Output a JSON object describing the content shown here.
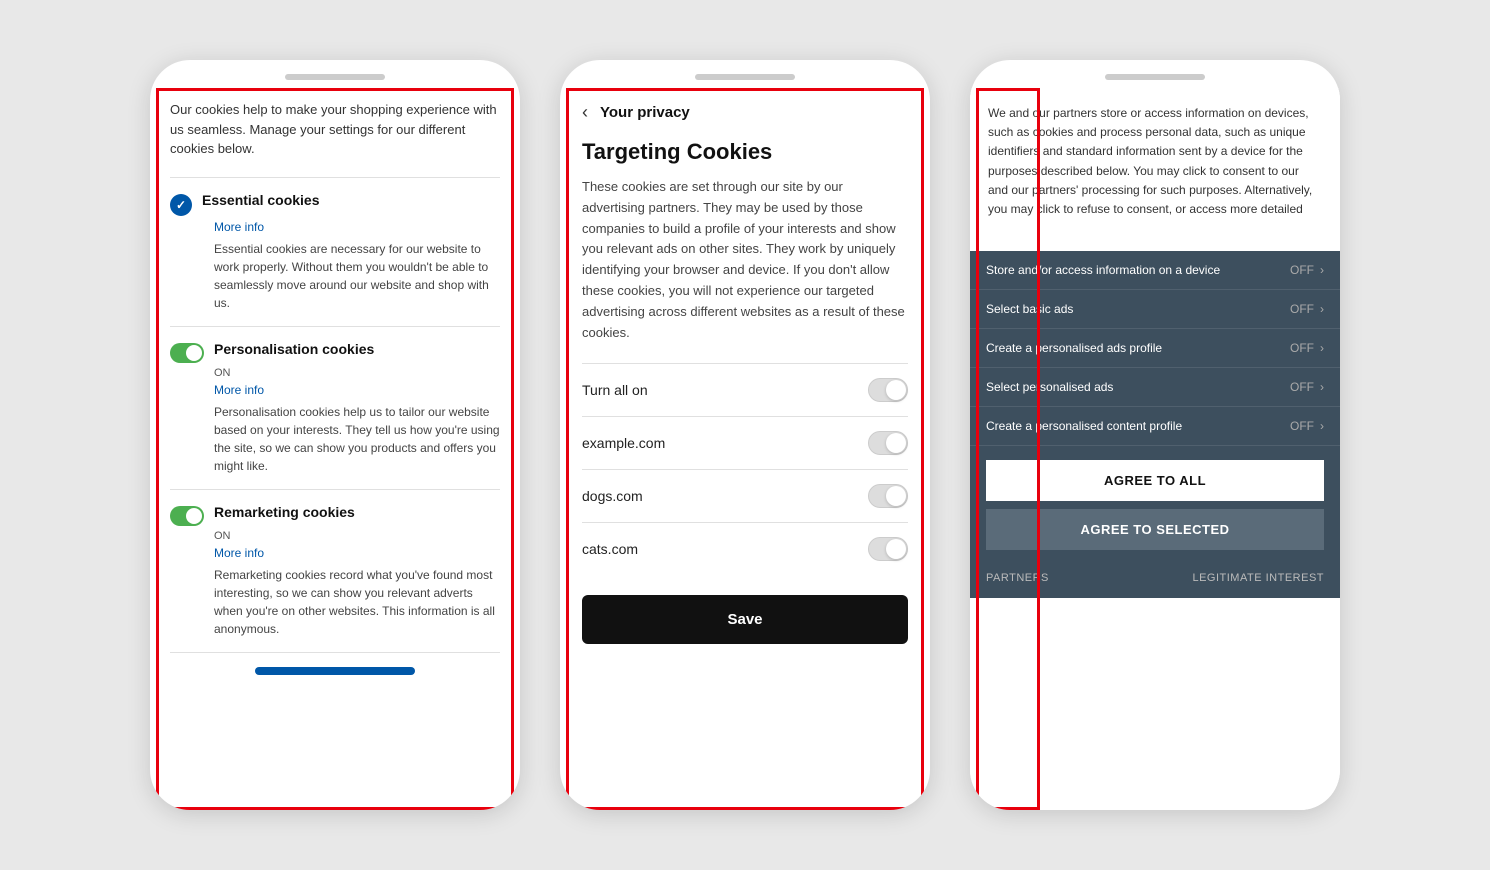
{
  "phone1": {
    "intro": "Our cookies help to make your shopping experience with us seamless. Manage your settings for our different cookies below.",
    "sections": [
      {
        "id": "essential",
        "icon": "check",
        "title": "Essential cookies",
        "more_info": "More info",
        "description": "Essential cookies are necessary for our website to work properly. Without them you wouldn't be able to seamlessly move around our website and shop with us."
      },
      {
        "id": "personalisation",
        "icon": "toggle",
        "title": "Personalisation cookies",
        "on_label": "ON",
        "more_info": "More info",
        "description": "Personalisation cookies help us to tailor our website based on your interests. They tell us how you're using the site, so we can show you products and offers you might like."
      },
      {
        "id": "remarketing",
        "icon": "toggle",
        "title": "Remarketing cookies",
        "on_label": "ON",
        "more_info": "More info",
        "description": "Remarketing cookies record what you've found most interesting, so we can show you relevant adverts when you're on other websites. This information is all anonymous."
      }
    ]
  },
  "phone2": {
    "back_label": "‹",
    "header_title": "Your privacy",
    "section_title": "Targeting Cookies",
    "description": "These cookies are set through our site by our advertising partners. They may be used by those companies to build a profile of your interests and show you relevant ads on other sites. They work by uniquely identifying your browser and device. If you don't allow these cookies, you will not experience our targeted advertising across different websites as a result of these cookies.",
    "toggles": [
      {
        "label": "Turn all on"
      },
      {
        "label": "example.com"
      },
      {
        "label": "dogs.com"
      },
      {
        "label": "cats.com"
      }
    ],
    "save_label": "Save"
  },
  "phone3": {
    "intro_text": "We and our partners store or access information on devices, such as cookies and process personal data, such as unique identifiers and standard information sent by a device for the purposes described below. You may click to consent to our and our partners' processing for such purposes. Alternatively, you may click to refuse to consent, or access more detailed",
    "consent_rows": [
      {
        "label": "Store and/or access information on a device",
        "status": "OFF"
      },
      {
        "label": "Select basic ads",
        "status": "OFF"
      },
      {
        "label": "Create a personalised ads profile",
        "status": "OFF"
      },
      {
        "label": "Select personalised ads",
        "status": "OFF"
      },
      {
        "label": "Create a personalised content profile",
        "status": "OFF"
      }
    ],
    "agree_to_all_label": "AGREE TO ALL",
    "agree_to_selected_label": "AGREE TO SELECTED",
    "footer_left": "PARTNERS",
    "footer_right": "LEGITIMATE INTEREST"
  }
}
